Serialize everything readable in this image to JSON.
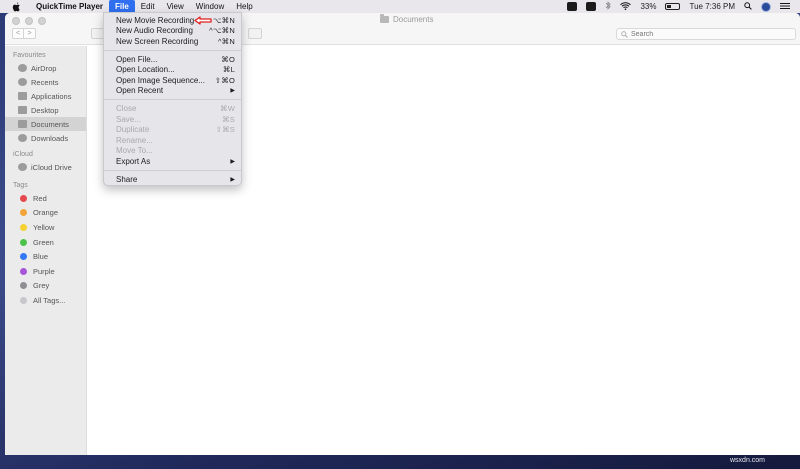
{
  "menubar": {
    "app_name": "QuickTime Player",
    "menus": [
      "File",
      "Edit",
      "View",
      "Window",
      "Help"
    ],
    "battery": "33%",
    "clock": "Tue 7:36 PM"
  },
  "window": {
    "title": "Documents",
    "search_placeholder": "Search"
  },
  "sidebar": {
    "favourites_heading": "Favourites",
    "favourites": [
      "AirDrop",
      "Recents",
      "Applications",
      "Desktop",
      "Documents",
      "Downloads"
    ],
    "icloud_heading": "iCloud",
    "icloud": [
      "iCloud Drive"
    ],
    "tags_heading": "Tags",
    "tags": [
      {
        "label": "Red",
        "color": "#e5484d"
      },
      {
        "label": "Orange",
        "color": "#f2a43a"
      },
      {
        "label": "Yellow",
        "color": "#f5d230"
      },
      {
        "label": "Green",
        "color": "#4cc24a"
      },
      {
        "label": "Blue",
        "color": "#3478f6"
      },
      {
        "label": "Purple",
        "color": "#a855d8"
      },
      {
        "label": "Grey",
        "color": "#8e8e93"
      }
    ],
    "all_tags": "All Tags..."
  },
  "file_menu": {
    "group1": [
      {
        "label": "New Movie Recording",
        "shortcut": "⌥⌘N"
      },
      {
        "label": "New Audio Recording",
        "shortcut": "^⌥⌘N"
      },
      {
        "label": "New Screen Recording",
        "shortcut": "^⌘N"
      }
    ],
    "group2": [
      {
        "label": "Open File...",
        "shortcut": "⌘O"
      },
      {
        "label": "Open Location...",
        "shortcut": "⌘L"
      },
      {
        "label": "Open Image Sequence...",
        "shortcut": "⇧⌘O"
      },
      {
        "label": "Open Recent",
        "shortcut": "▶"
      }
    ],
    "group3": [
      {
        "label": "Close",
        "shortcut": "⌘W"
      },
      {
        "label": "Save...",
        "shortcut": "⌘S"
      },
      {
        "label": "Duplicate",
        "shortcut": "⇧⌘S"
      },
      {
        "label": "Rename...",
        "shortcut": ""
      },
      {
        "label": "Move To...",
        "shortcut": ""
      },
      {
        "label": "Export As",
        "shortcut": "▶"
      }
    ],
    "group4": [
      {
        "label": "Share",
        "shortcut": "▶"
      }
    ]
  },
  "watermark": "wsxdn.com",
  "colors": {
    "menu_highlight": "#2f6ff0",
    "annotation_arrow": "#e0201b"
  }
}
